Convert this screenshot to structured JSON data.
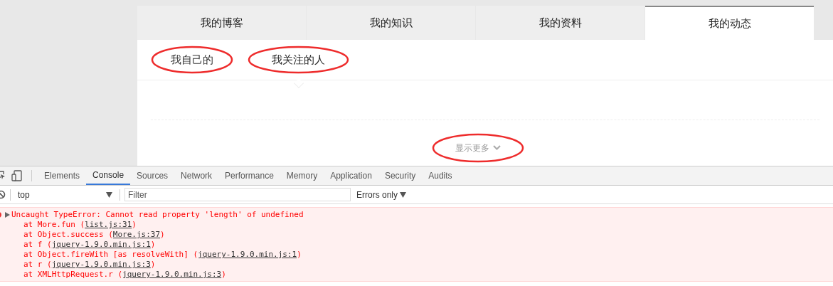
{
  "page": {
    "tabs": [
      {
        "label": "我的博客",
        "selected": false
      },
      {
        "label": "我的知识",
        "selected": false
      },
      {
        "label": "我的资料",
        "selected": false
      },
      {
        "label": "我的动态",
        "selected": true
      }
    ],
    "subtabs": [
      {
        "label": "我自己的",
        "selected": false,
        "circled": true
      },
      {
        "label": "我关注的人",
        "selected": true,
        "circled": true
      }
    ],
    "show_more": {
      "label": "显示更多",
      "circled": true
    }
  },
  "devtools": {
    "tabs": [
      {
        "label": "Elements",
        "selected": false
      },
      {
        "label": "Console",
        "selected": true
      },
      {
        "label": "Sources",
        "selected": false
      },
      {
        "label": "Network",
        "selected": false
      },
      {
        "label": "Performance",
        "selected": false
      },
      {
        "label": "Memory",
        "selected": false
      },
      {
        "label": "Application",
        "selected": false
      },
      {
        "label": "Security",
        "selected": false
      },
      {
        "label": "Audits",
        "selected": false
      }
    ],
    "context": "top",
    "filter": {
      "placeholder": "Filter"
    },
    "level": "Errors only",
    "error": {
      "message": "Uncaught TypeError: Cannot read property 'length' of undefined",
      "frames": [
        {
          "text": "at More.fun (",
          "link": "list.js:31",
          "close": ")"
        },
        {
          "text": "at Object.success (",
          "link": "More.js:37",
          "close": ")"
        },
        {
          "text": "at f (",
          "link": "jquery-1.9.0.min.js:1",
          "close": ")"
        },
        {
          "text": "at Object.fireWith [as resolveWith] (",
          "link": "jquery-1.9.0.min.js:1",
          "close": ")"
        },
        {
          "text": "at r (",
          "link": "jquery-1.9.0.min.js:3",
          "close": ")"
        },
        {
          "text": "at XMLHttpRequest.r (",
          "link": "jquery-1.9.0.min.js:3",
          "close": ")"
        }
      ]
    }
  }
}
